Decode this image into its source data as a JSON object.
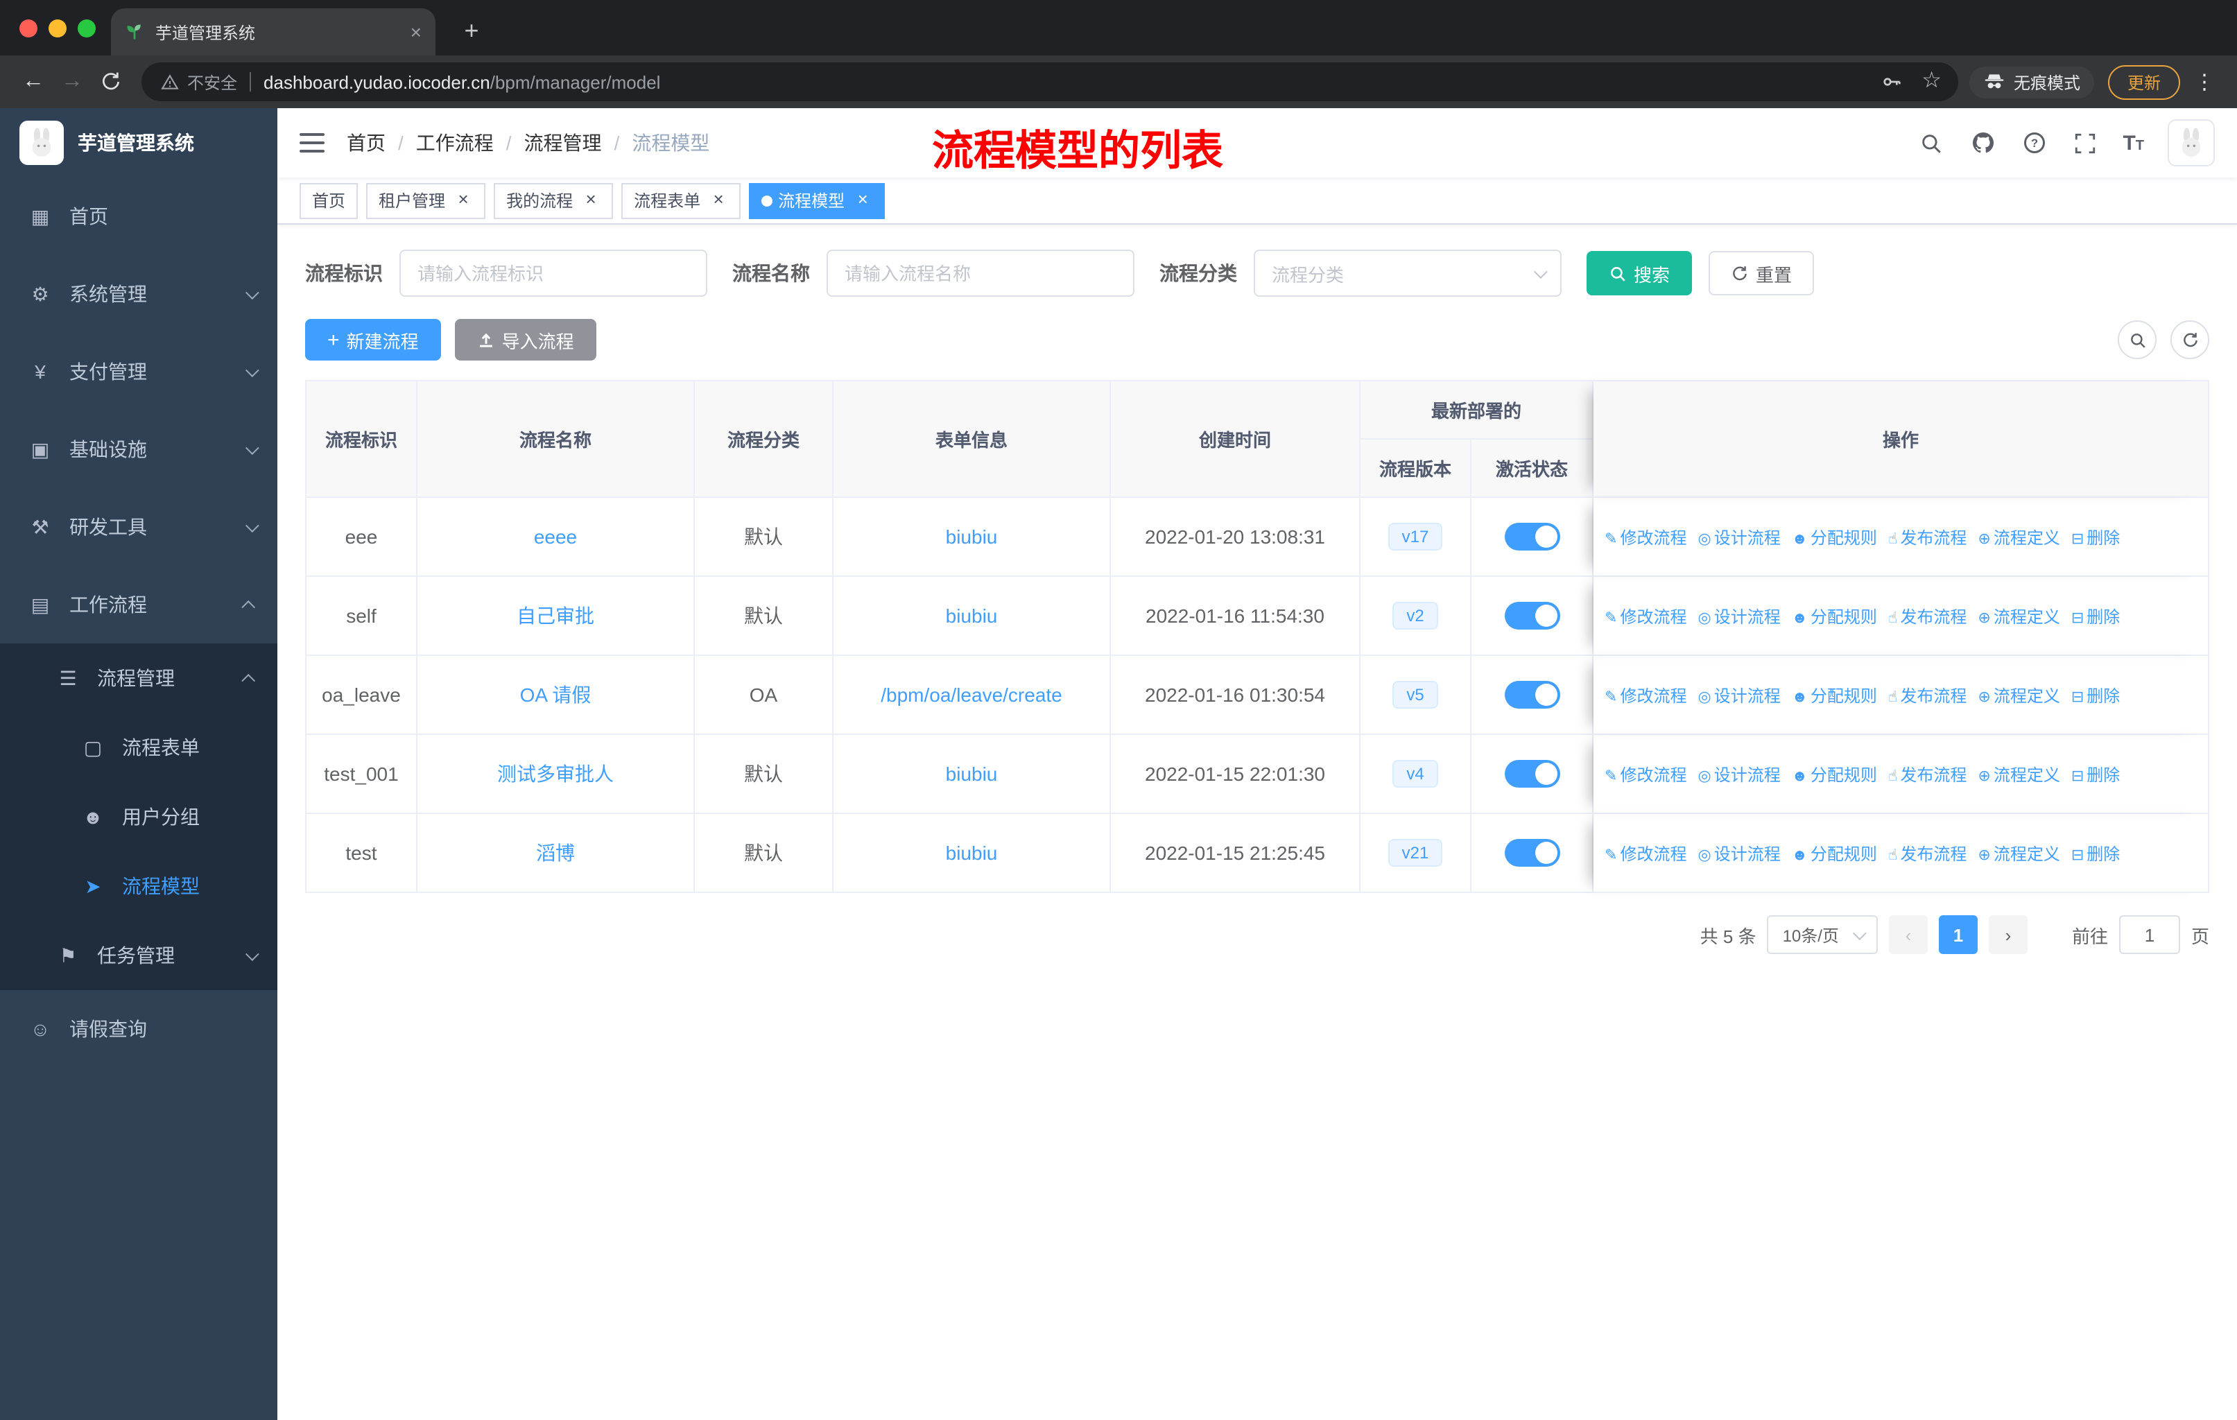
{
  "colors": {
    "primary": "#409EFF",
    "search_button": "#1ABC9C",
    "info_button": "#909399",
    "sidebar_bg": "#304156",
    "submenu_bg": "#1F2D3D",
    "sidebar_text": "#BFCBD9",
    "annotation": "#FD0100",
    "version_badge_bg": "#ECF5FF"
  },
  "browser": {
    "tab": {
      "title": "芋道管理系统",
      "close": "×"
    },
    "new_tab_button": "+",
    "toolbar": {
      "security_label": "不安全",
      "url_host": "dashboard.yudao.iocoder.cn",
      "url_path": "/bpm/manager/model",
      "incognito_label": "无痕模式",
      "update_label": "更新",
      "menu_dots": "⋮",
      "back": "←",
      "forward": "→",
      "star": "☆"
    }
  },
  "app": {
    "logo_title": "芋道管理系统",
    "annotation": "流程模型的列表",
    "breadcrumb": [
      "首页",
      "工作流程",
      "流程管理",
      "流程模型"
    ],
    "sidebar": [
      {
        "label": "首页",
        "icon": "dashboard-icon",
        "glyph": "▦",
        "type": "item"
      },
      {
        "label": "系统管理",
        "icon": "gear-icon",
        "glyph": "⚙",
        "type": "group",
        "state": "collapsed"
      },
      {
        "label": "支付管理",
        "icon": "payment-icon",
        "glyph": "¥",
        "type": "group",
        "state": "collapsed"
      },
      {
        "label": "基础设施",
        "icon": "infrastructure-icon",
        "glyph": "▣",
        "type": "group",
        "state": "collapsed"
      },
      {
        "label": "研发工具",
        "icon": "tools-icon",
        "glyph": "⚒",
        "type": "group",
        "state": "collapsed"
      },
      {
        "label": "工作流程",
        "icon": "workflow-icon",
        "glyph": "▤",
        "type": "group",
        "state": "expanded",
        "children": [
          {
            "label": "流程管理",
            "icon": "process-management-icon",
            "glyph": "☰",
            "type": "group",
            "state": "expanded",
            "children": [
              {
                "label": "流程表单",
                "icon": "form-icon",
                "glyph": "▢",
                "type": "item"
              },
              {
                "label": "用户分组",
                "icon": "user-group-icon",
                "glyph": "☻",
                "type": "item"
              },
              {
                "label": "流程模型",
                "icon": "model-icon",
                "glyph": "➤",
                "type": "item",
                "active": true
              }
            ]
          },
          {
            "label": "任务管理",
            "icon": "task-icon",
            "glyph": "⚑",
            "type": "group",
            "state": "collapsed"
          }
        ]
      },
      {
        "label": "请假查询",
        "icon": "user-icon",
        "glyph": "☺",
        "type": "item"
      }
    ],
    "tags": [
      {
        "label": "首页",
        "closable": false,
        "active": false
      },
      {
        "label": "租户管理",
        "closable": true,
        "active": false
      },
      {
        "label": "我的流程",
        "closable": true,
        "active": false
      },
      {
        "label": "流程表单",
        "closable": true,
        "active": false
      },
      {
        "label": "流程模型",
        "closable": true,
        "active": true
      }
    ],
    "filters": {
      "fields": [
        {
          "label": "流程标识",
          "placeholder": "请输入流程标识",
          "type": "input"
        },
        {
          "label": "流程名称",
          "placeholder": "请输入流程名称",
          "type": "input"
        },
        {
          "label": "流程分类",
          "placeholder": "流程分类",
          "type": "select"
        }
      ],
      "search_label": "搜索",
      "reset_label": "重置"
    },
    "actions": {
      "create_label": "新建流程",
      "import_label": "导入流程"
    },
    "table": {
      "columns": [
        "流程标识",
        "流程名称",
        "流程分类",
        "表单信息",
        "创建时间"
      ],
      "group_header": "最新部署的",
      "sub_columns": [
        "流程版本",
        "激活状态"
      ],
      "ops_header": "操作",
      "row_actions": [
        {
          "label": "修改流程",
          "name": "edit-process",
          "icon": "edit-icon",
          "glyph": "✎"
        },
        {
          "label": "设计流程",
          "name": "design-process",
          "icon": "design-icon",
          "glyph": "◎"
        },
        {
          "label": "分配规则",
          "name": "assign-rule",
          "icon": "assign-rule-icon",
          "glyph": "☻"
        },
        {
          "label": "发布流程",
          "name": "publish-process",
          "icon": "publish-icon",
          "glyph": "☝"
        },
        {
          "label": "流程定义",
          "name": "process-definition",
          "icon": "definition-icon",
          "glyph": "⊕"
        },
        {
          "label": "删除",
          "name": "delete",
          "icon": "delete-icon",
          "glyph": "⊟"
        }
      ],
      "rows": [
        {
          "id": "eee",
          "name": "eeee",
          "category": "默认",
          "form": "biubiu",
          "created": "2022-01-20 13:08:31",
          "version": "v17",
          "active": true
        },
        {
          "id": "self",
          "name": "自己审批",
          "category": "默认",
          "form": "biubiu",
          "created": "2022-01-16 11:54:30",
          "version": "v2",
          "active": true
        },
        {
          "id": "oa_leave",
          "name": "OA 请假",
          "category": "OA",
          "form": "/bpm/oa/leave/create",
          "created": "2022-01-16 01:30:54",
          "version": "v5",
          "active": true
        },
        {
          "id": "test_001",
          "name": "测试多审批人",
          "category": "默认",
          "form": "biubiu",
          "created": "2022-01-15 22:01:30",
          "version": "v4",
          "active": true
        },
        {
          "id": "test",
          "name": "滔博",
          "category": "默认",
          "form": "biubiu",
          "created": "2022-01-15 21:25:45",
          "version": "v21",
          "active": true
        }
      ]
    },
    "pagination": {
      "total": "共 5 条",
      "page_size": "10条/页",
      "prev": "‹",
      "current": "1",
      "next": "›",
      "goto_prefix": "前往",
      "goto_value": "1",
      "goto_suffix": "页"
    }
  }
}
